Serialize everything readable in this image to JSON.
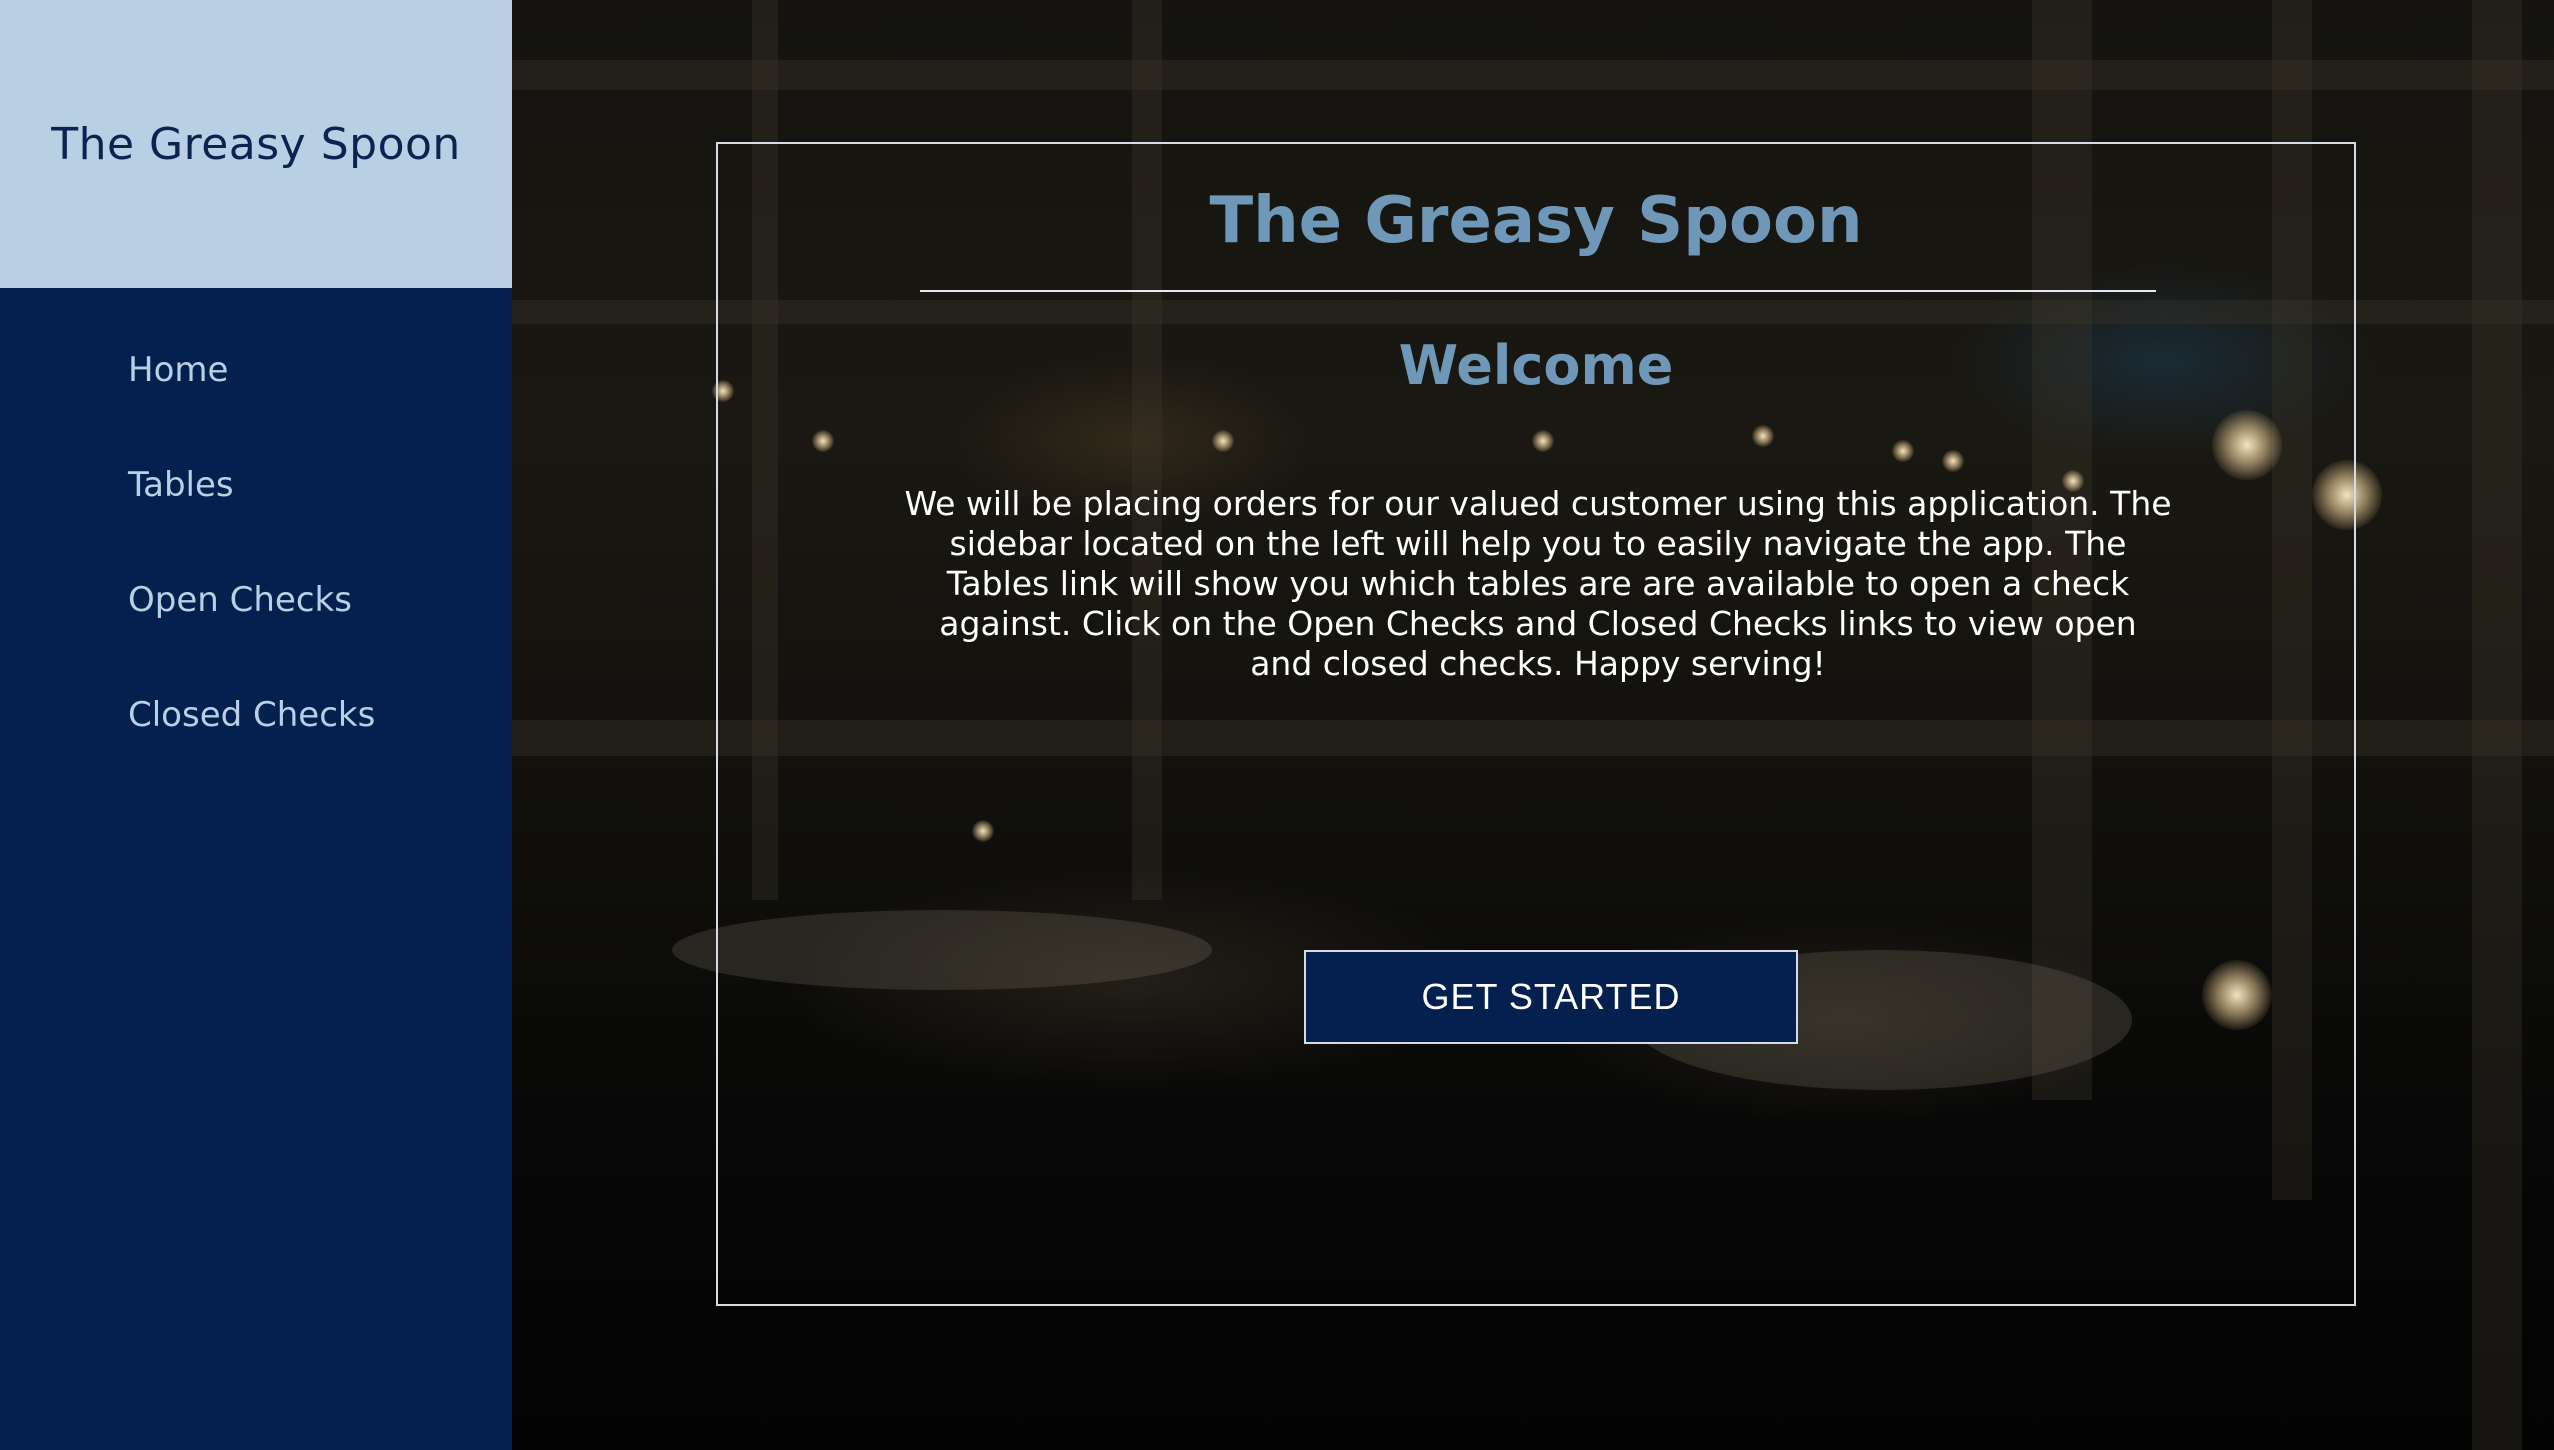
{
  "sidebar": {
    "brand": "The Greasy Spoon",
    "items": [
      {
        "label": "Home"
      },
      {
        "label": "Tables"
      },
      {
        "label": "Open Checks"
      },
      {
        "label": "Closed Checks"
      }
    ]
  },
  "main": {
    "title": "The Greasy Spoon",
    "heading": "Welcome",
    "intro": "We will be placing orders for our valued customer using this application. The sidebar located on the left will help you to easily navigate the app. The Tables link will show you which tables are are available to open a check against. Click on the Open Checks and Closed Checks links to view open and closed checks. Happy serving!",
    "cta_label": "GET STARTED"
  },
  "colors": {
    "sidebar_bg": "#03204f",
    "brand_bg": "#b9d0e4",
    "accent_text": "#6f98b8",
    "nav_text": "#b9d0e4"
  }
}
